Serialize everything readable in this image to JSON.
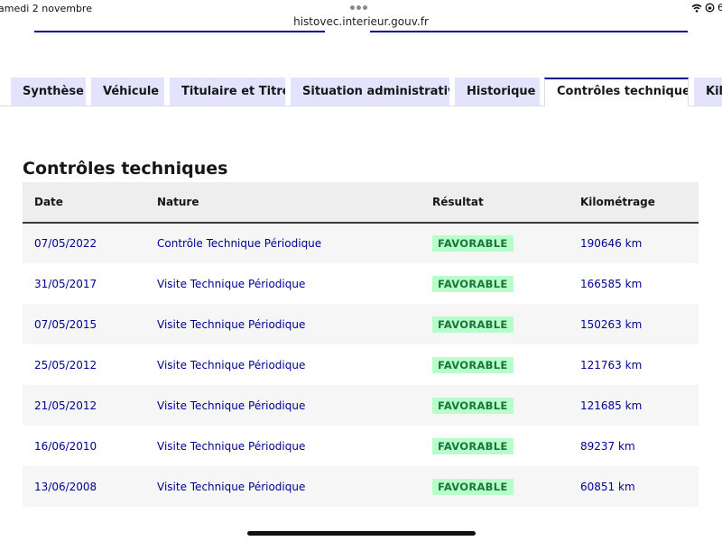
{
  "status_bar": {
    "datetime": "amedi 2 novembre",
    "battery": "6"
  },
  "browser": {
    "url": "histovec.interieur.gouv.fr"
  },
  "colors": {
    "accent": "#000091",
    "tab_bg": "#e3e3fd",
    "badge_bg": "#b8fec9",
    "badge_text": "#18753c"
  },
  "tabs": [
    {
      "label": "Synthèse",
      "active": false
    },
    {
      "label": "Véhicule",
      "active": false
    },
    {
      "label": "Titulaire et Titre",
      "active": false
    },
    {
      "label": "Situation administrative",
      "active": false
    },
    {
      "label": "Historique",
      "active": false
    },
    {
      "label": "Contrôles techniques",
      "active": true
    },
    {
      "label": "Kilo",
      "active": false
    }
  ],
  "section": {
    "title": "Contrôles techniques"
  },
  "table": {
    "headers": {
      "date": "Date",
      "nature": "Nature",
      "result": "Résultat",
      "mileage": "Kilométrage"
    },
    "rows": [
      {
        "date": "07/05/2022",
        "nature": "Contrôle Technique Périodique",
        "result": "FAVORABLE",
        "mileage": "190646 km"
      },
      {
        "date": "31/05/2017",
        "nature": "Visite Technique Périodique",
        "result": "FAVORABLE",
        "mileage": "166585 km"
      },
      {
        "date": "07/05/2015",
        "nature": "Visite Technique Périodique",
        "result": "FAVORABLE",
        "mileage": "150263 km"
      },
      {
        "date": "25/05/2012",
        "nature": "Visite Technique Périodique",
        "result": "FAVORABLE",
        "mileage": "121763 km"
      },
      {
        "date": "21/05/2012",
        "nature": "Visite Technique Périodique",
        "result": "FAVORABLE",
        "mileage": "121685 km"
      },
      {
        "date": "16/06/2010",
        "nature": "Visite Technique Périodique",
        "result": "FAVORABLE",
        "mileage": "89237 km"
      },
      {
        "date": "13/06/2008",
        "nature": "Visite Technique Périodique",
        "result": "FAVORABLE",
        "mileage": "60851 km"
      }
    ]
  }
}
